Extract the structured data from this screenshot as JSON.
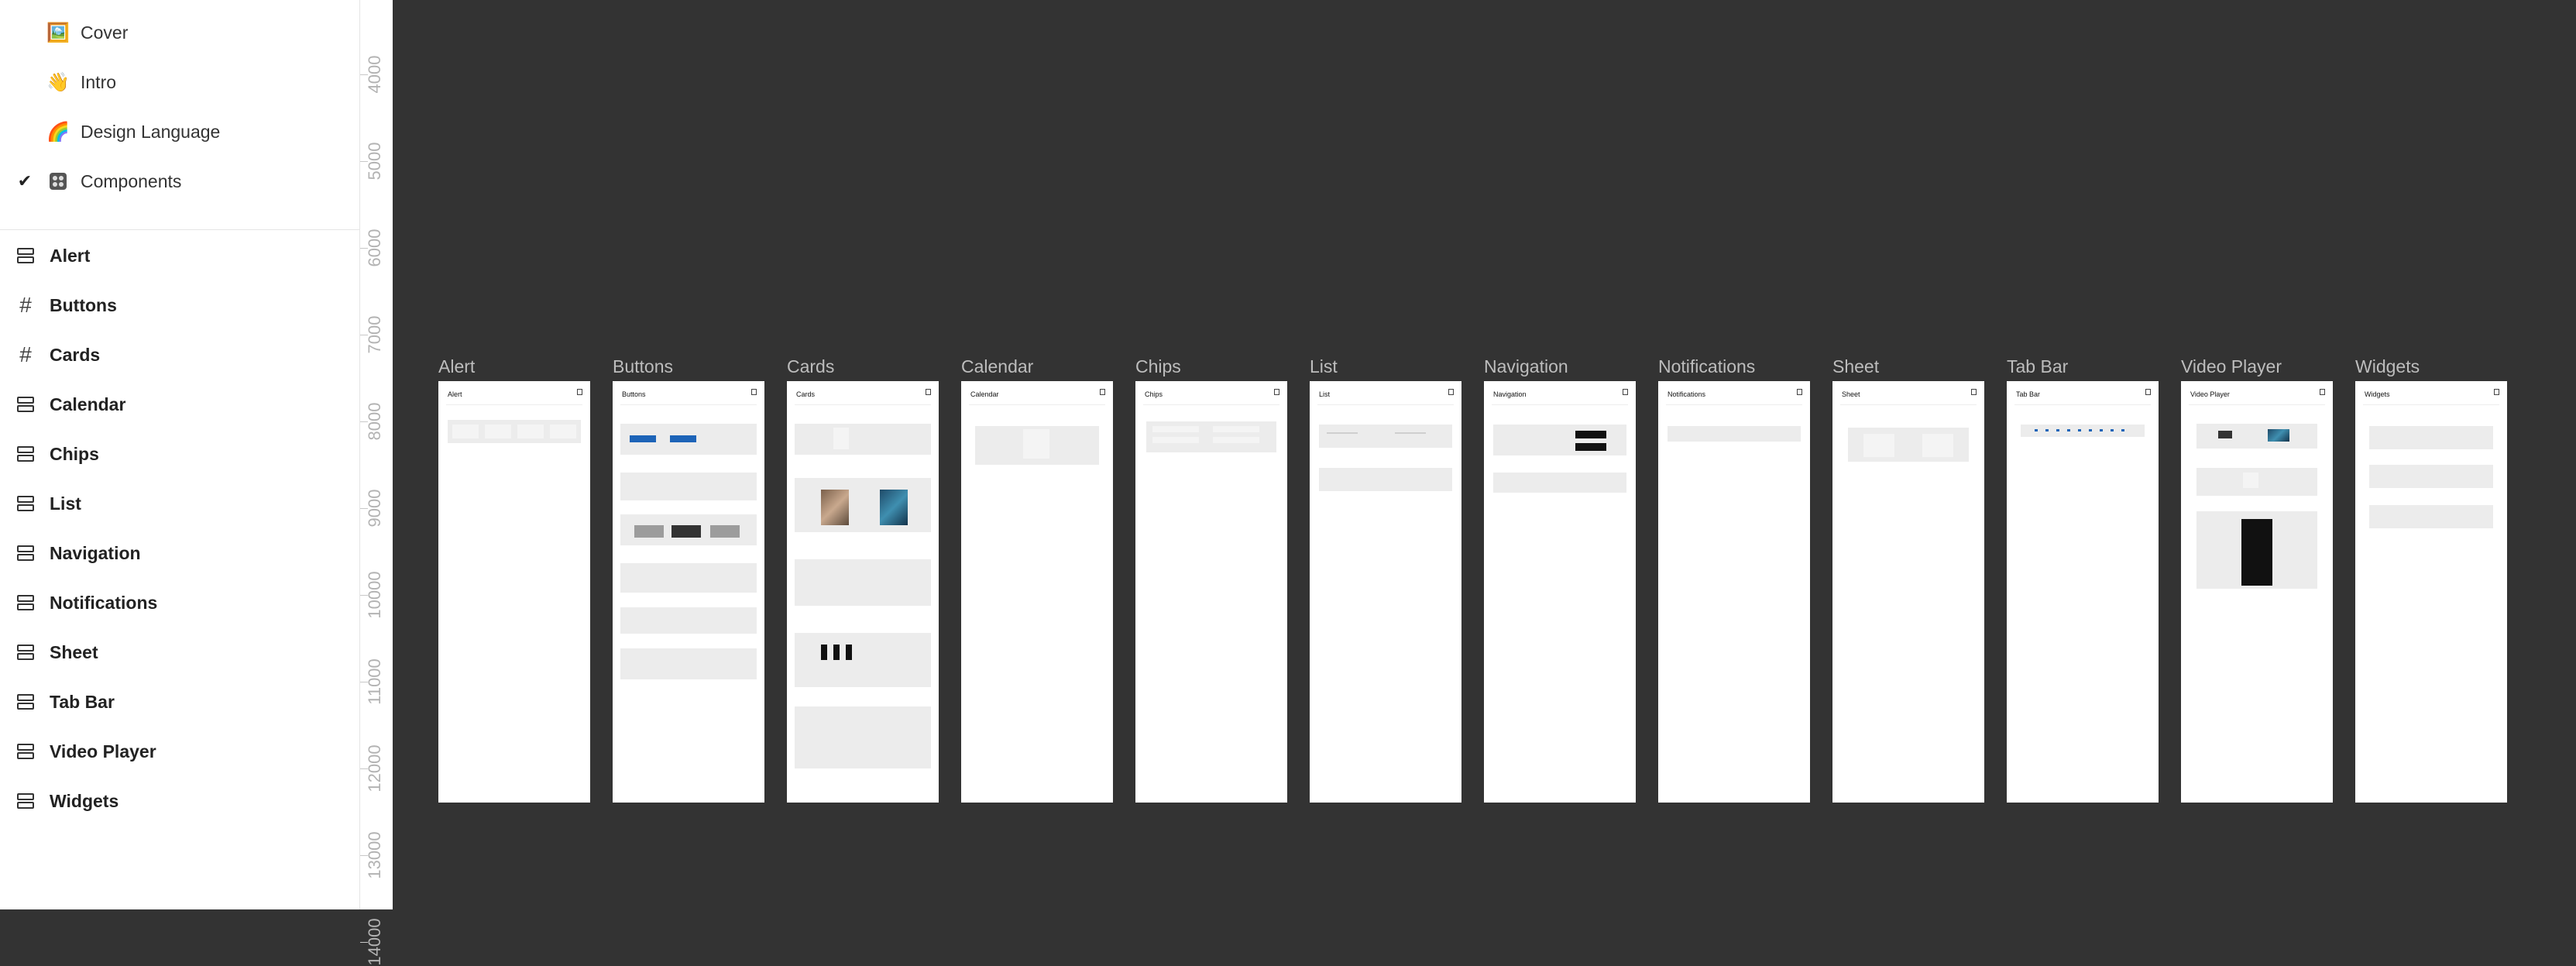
{
  "pages": [
    {
      "label": "Cover",
      "icon": "framed-picture-icon",
      "emoji": "🖼️",
      "current": false
    },
    {
      "label": "Intro",
      "icon": "waving-hand-icon",
      "emoji": "👋",
      "current": false
    },
    {
      "label": "Design Language",
      "icon": "rainbow-icon",
      "emoji": "🌈",
      "current": false
    },
    {
      "label": "Components",
      "icon": "control-knobs-icon",
      "emoji": "🎛️",
      "current": true
    }
  ],
  "layers": [
    {
      "label": "Alert",
      "icon": "section-icon",
      "glyph": "section"
    },
    {
      "label": "Buttons",
      "icon": "frame-icon",
      "glyph": "#"
    },
    {
      "label": "Cards",
      "icon": "frame-icon",
      "glyph": "#"
    },
    {
      "label": "Calendar",
      "icon": "section-icon",
      "glyph": "section"
    },
    {
      "label": "Chips",
      "icon": "section-icon",
      "glyph": "section"
    },
    {
      "label": "List",
      "icon": "section-icon",
      "glyph": "section"
    },
    {
      "label": "Navigation",
      "icon": "section-icon",
      "glyph": "section"
    },
    {
      "label": "Notifications",
      "icon": "section-icon",
      "glyph": "section"
    },
    {
      "label": "Sheet",
      "icon": "section-icon",
      "glyph": "section"
    },
    {
      "label": "Tab Bar",
      "icon": "section-icon",
      "glyph": "section"
    },
    {
      "label": "Video Player",
      "icon": "section-icon",
      "glyph": "section"
    },
    {
      "label": "Widgets",
      "icon": "section-icon",
      "glyph": "section"
    }
  ],
  "ruler": [
    "4000",
    "5000",
    "6000",
    "7000",
    "8000",
    "9000",
    "10000",
    "11000",
    "12000",
    "13000",
    "14000"
  ],
  "frames": [
    {
      "title": "Alert"
    },
    {
      "title": "Buttons"
    },
    {
      "title": "Cards"
    },
    {
      "title": "Calendar"
    },
    {
      "title": "Chips"
    },
    {
      "title": "List"
    },
    {
      "title": "Navigation"
    },
    {
      "title": "Notifications"
    },
    {
      "title": "Sheet"
    },
    {
      "title": "Tab Bar"
    },
    {
      "title": "Video Player"
    },
    {
      "title": "Widgets"
    }
  ],
  "colors": {
    "canvas": "#333333",
    "panel": "#ffffff",
    "accent": "#1d64b8"
  }
}
